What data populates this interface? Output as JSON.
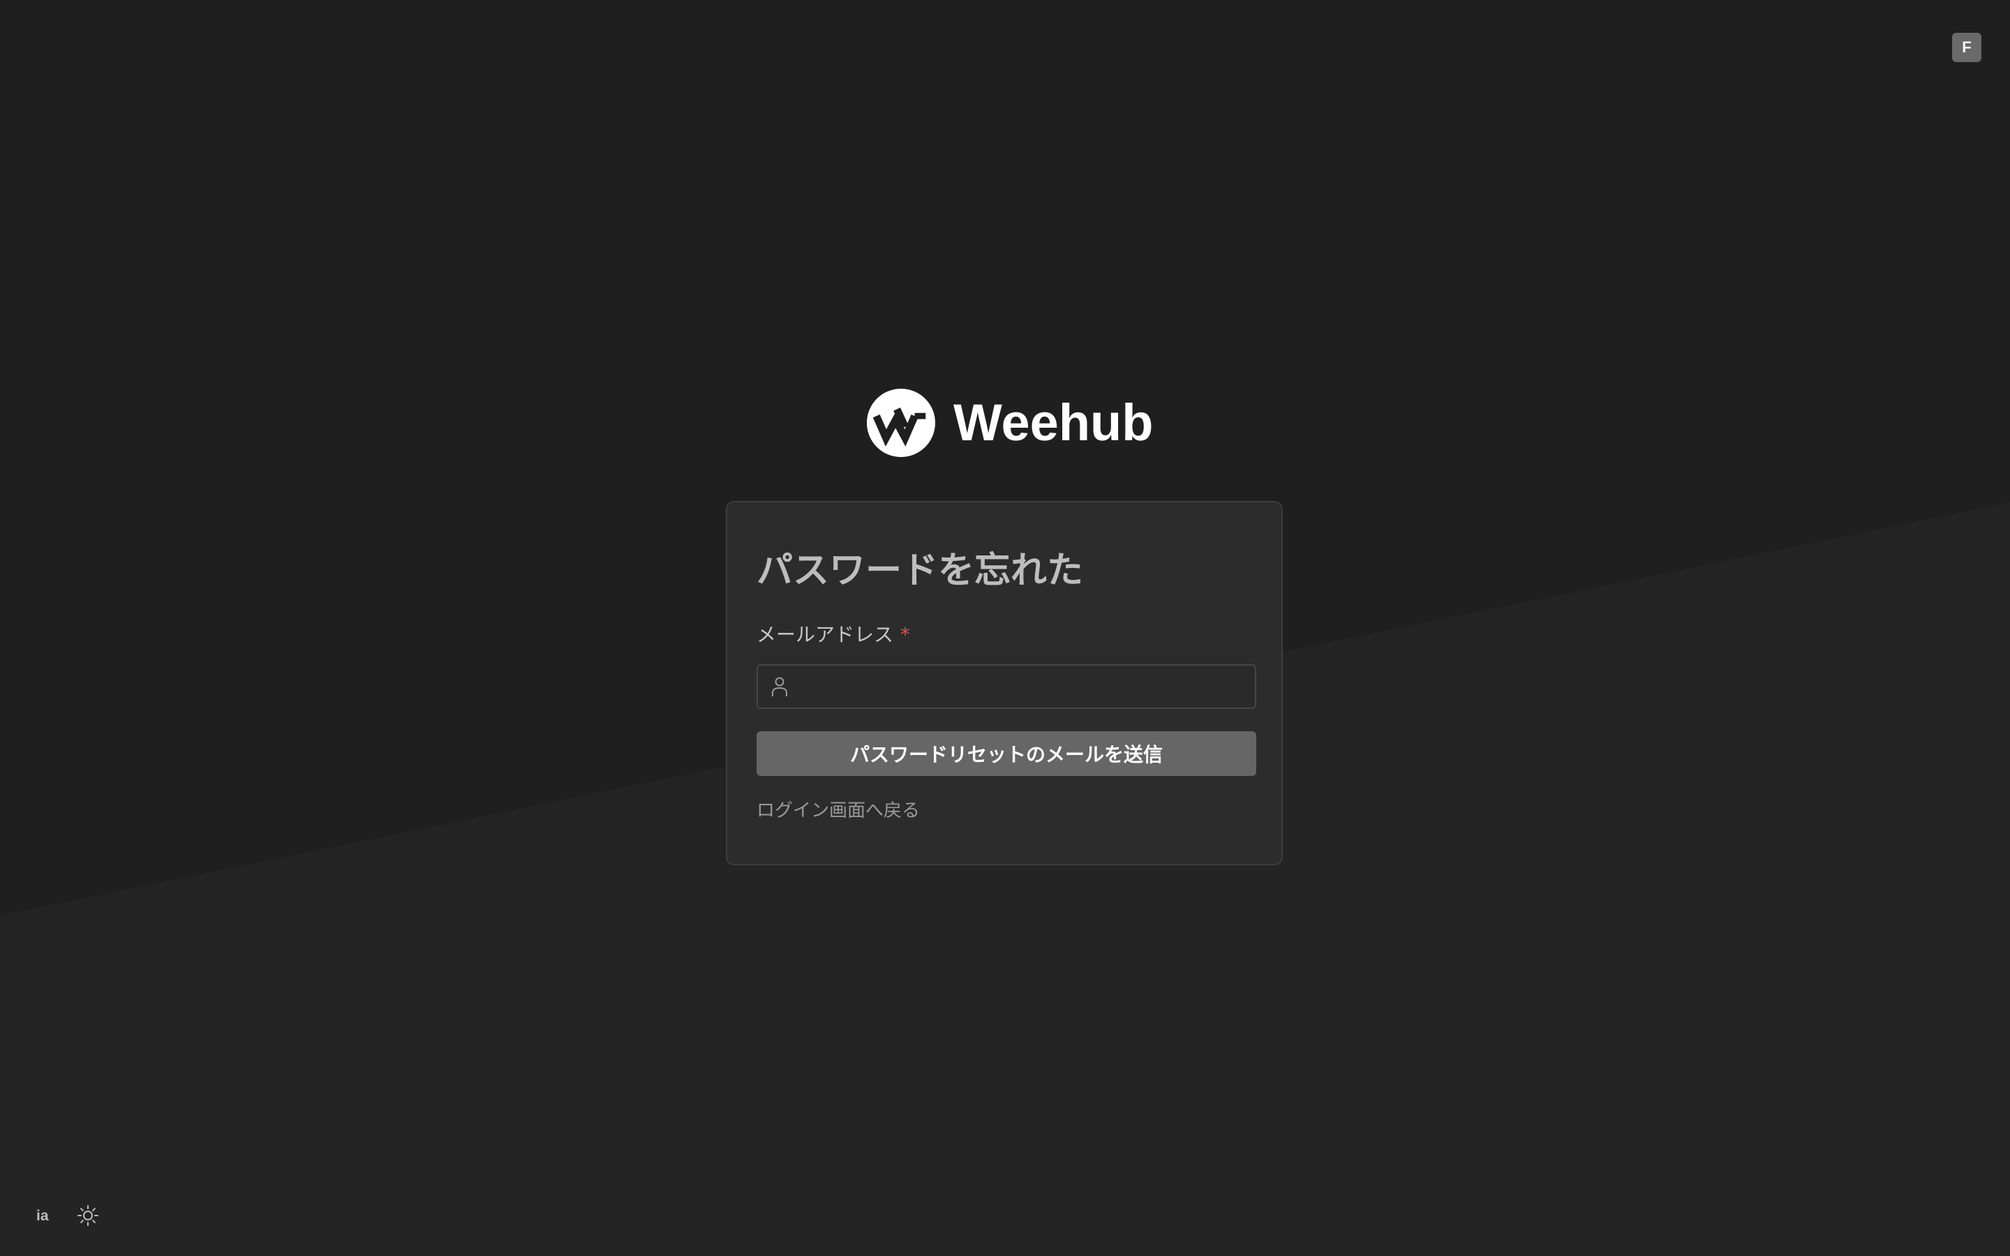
{
  "header": {
    "user_initial": "F"
  },
  "brand": {
    "name": "Weehub",
    "logo_icon": "weehub-logo-icon"
  },
  "form": {
    "title": "パスワードを忘れた",
    "email_label": "メールアドレス",
    "required_marker": "*",
    "email_value": "",
    "email_placeholder": "",
    "email_icon": "user-icon",
    "submit_label": "パスワードリセットのメールを送信",
    "back_link_label": "ログイン画面へ戻る"
  },
  "footer": {
    "language_label": "ia",
    "theme_icon": "sun-icon"
  },
  "colors": {
    "background": "#1f1f1f",
    "card": "#2c2c2c",
    "button": "#666666",
    "required": "#d9534f"
  }
}
